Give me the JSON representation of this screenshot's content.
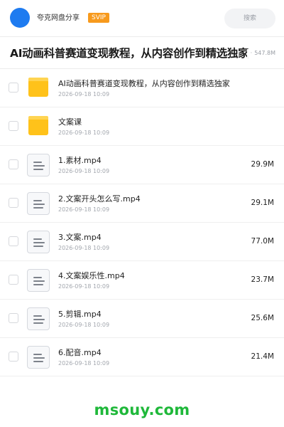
{
  "header": {
    "share_name": "夸克网盘分享",
    "badge": "SVIP",
    "search_placeholder": "搜索"
  },
  "title_bar": {
    "title": "AI动画科普赛道变现教程，从内容创作到精选独家",
    "total_size": "547.8M"
  },
  "files": [
    {
      "type": "folder",
      "name": "AI动画科普赛道变现教程，从内容创作到精选独家",
      "date": "2026-09-18 10:09",
      "size": ""
    },
    {
      "type": "folder",
      "name": "文案课",
      "date": "2026-09-18 10:09",
      "size": ""
    },
    {
      "type": "file",
      "name": "1.素材.mp4",
      "date": "2026-09-18 10:09",
      "size": "29.9M"
    },
    {
      "type": "file",
      "name": "2.文案开头怎么写.mp4",
      "date": "2026-09-18 10:09",
      "size": "29.1M"
    },
    {
      "type": "file",
      "name": "3.文案.mp4",
      "date": "2026-09-18 10:09",
      "size": "77.0M"
    },
    {
      "type": "file",
      "name": "4.文案娱乐性.mp4",
      "date": "2026-09-18 10:09",
      "size": "23.7M"
    },
    {
      "type": "file",
      "name": "5.剪辑.mp4",
      "date": "2026-09-18 10:09",
      "size": "25.6M"
    },
    {
      "type": "file",
      "name": "6.配音.mp4",
      "date": "2026-09-18 10:09",
      "size": "21.4M"
    }
  ],
  "footer": {
    "watermark": "msouy.com"
  },
  "colors": {
    "avatar": "#1e7bf0",
    "svip_badge": "#f79a1d",
    "folder": "#ffc21a",
    "watermark": "#1fb83a"
  }
}
